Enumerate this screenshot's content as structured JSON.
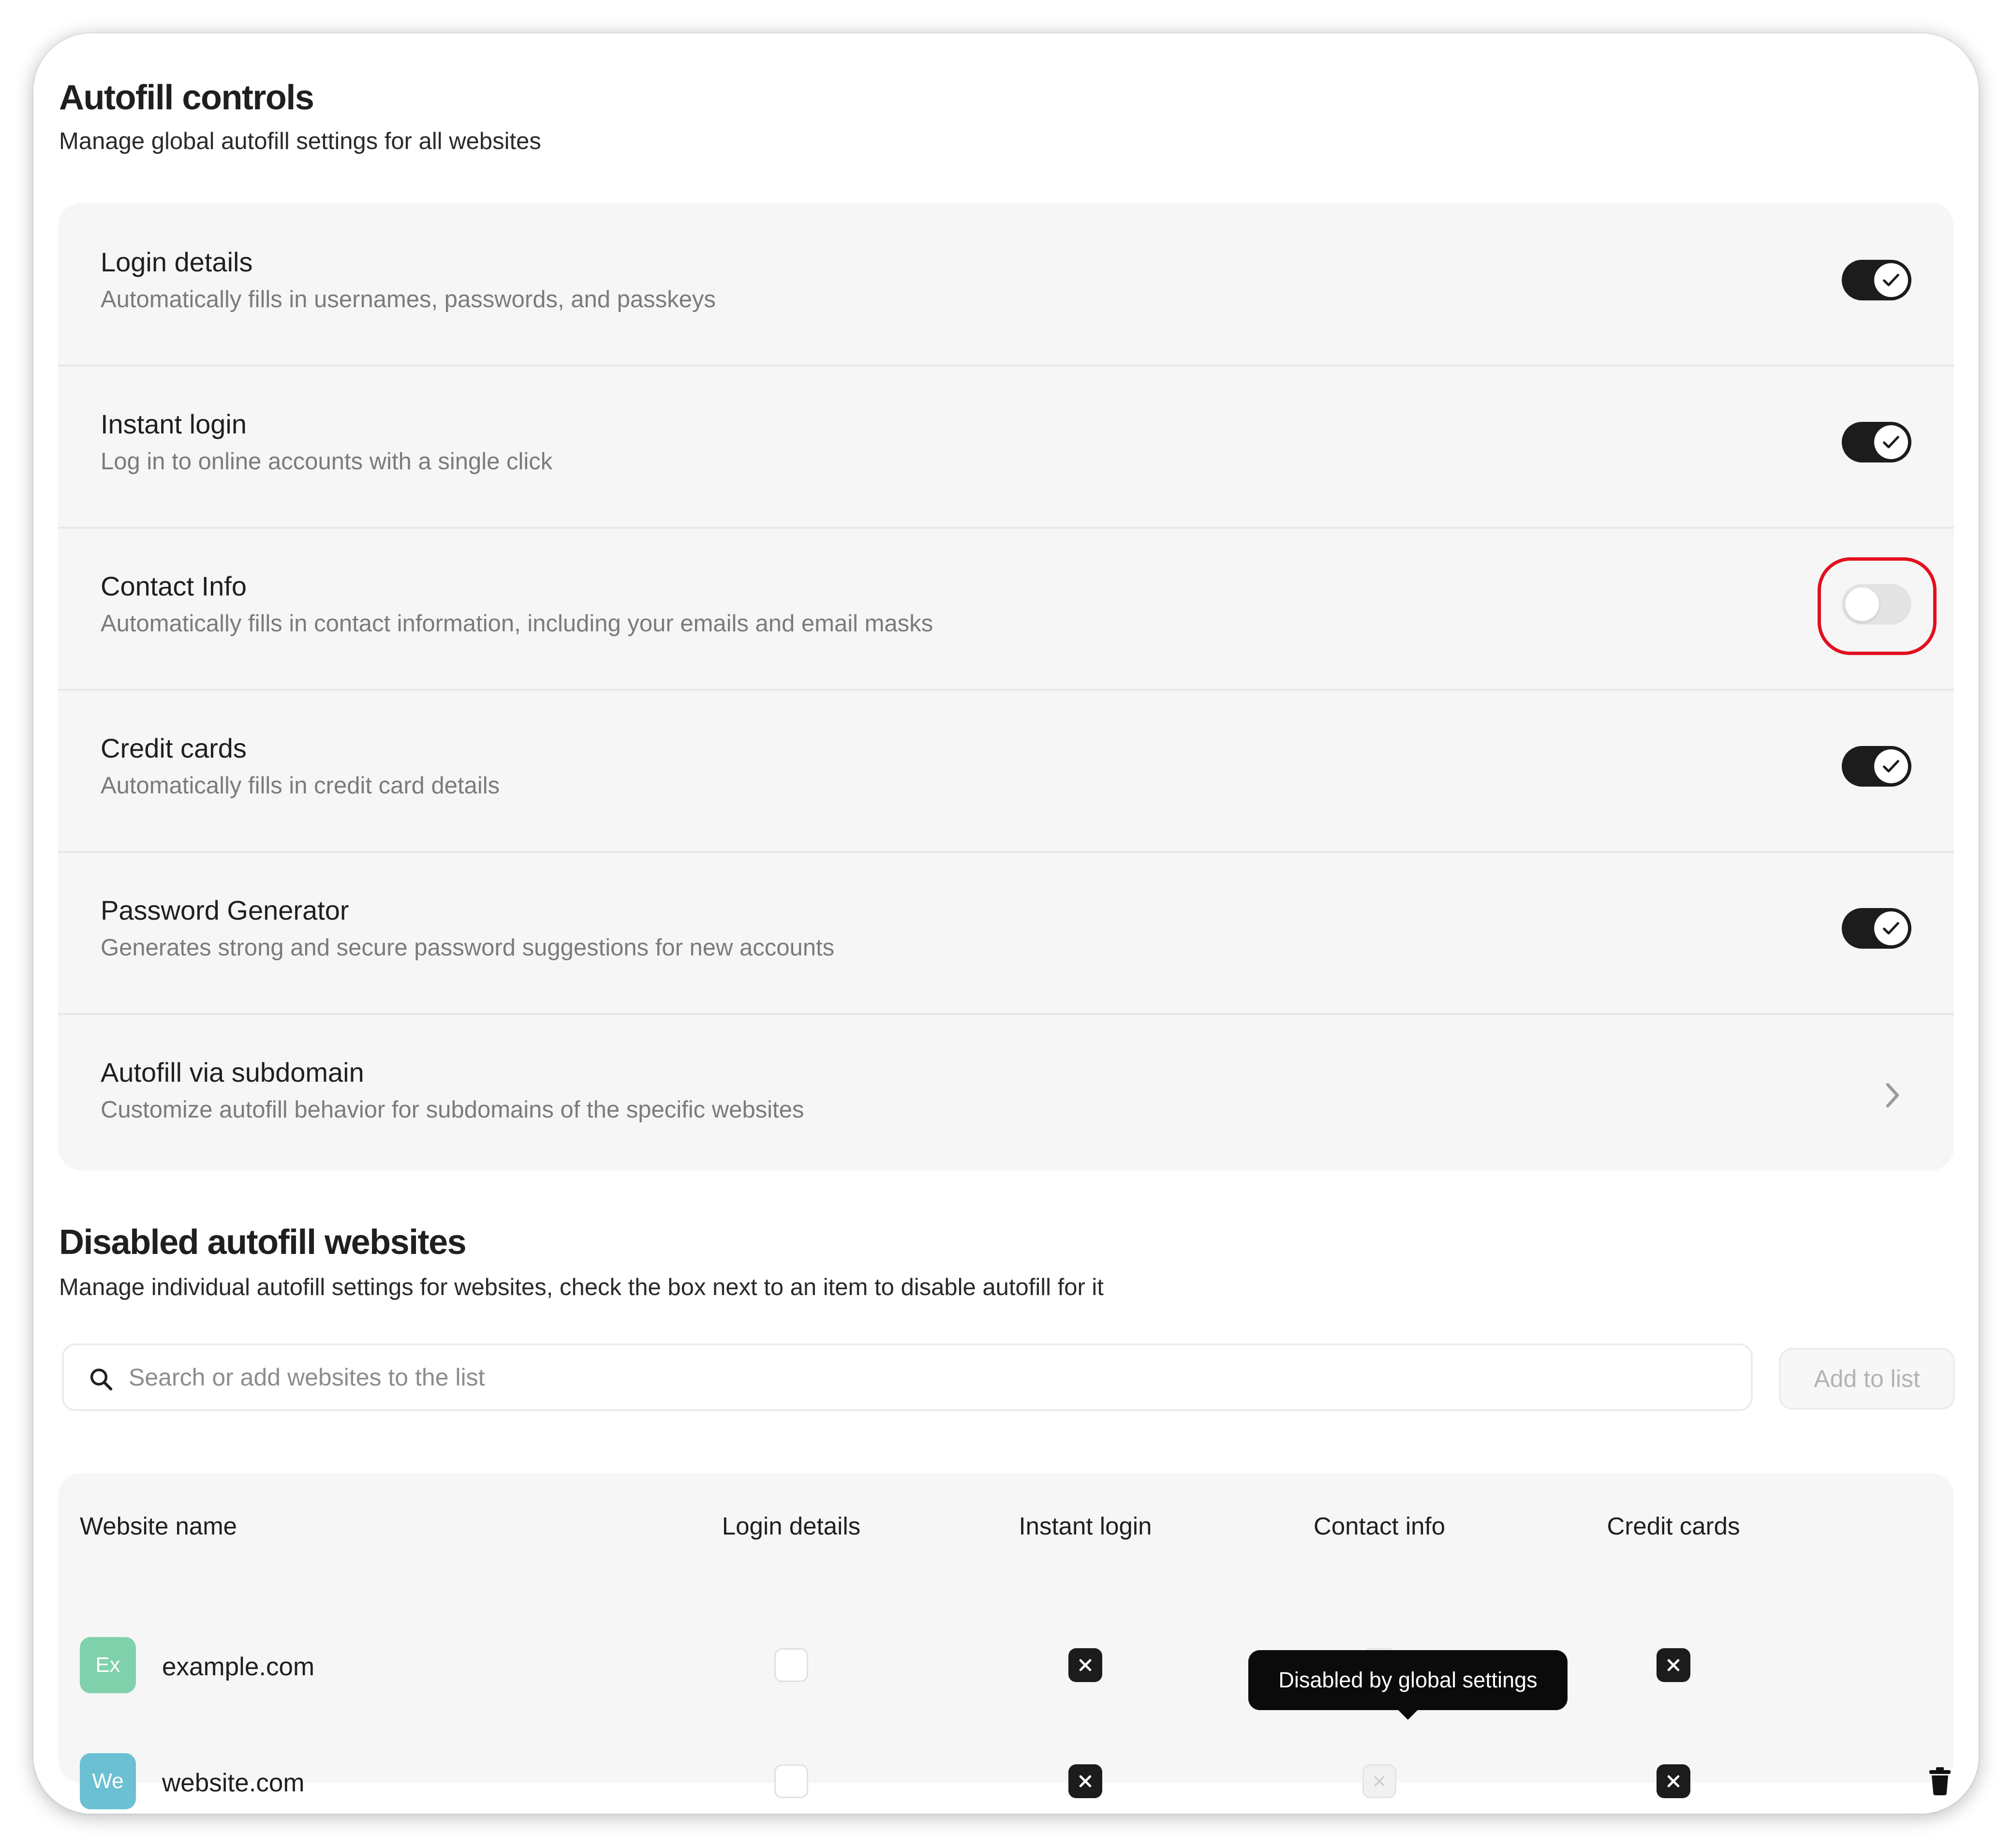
{
  "autofill": {
    "title": "Autofill controls",
    "subtitle": "Manage global autofill settings for all websites",
    "settings": [
      {
        "title": "Login details",
        "description": "Automatically fills in usernames, passwords, and passkeys",
        "control": "toggle",
        "enabled": true
      },
      {
        "title": "Instant login",
        "description": "Log in to online accounts with a single click",
        "control": "toggle",
        "enabled": true
      },
      {
        "title": "Contact Info",
        "description": "Automatically fills in contact information, including your emails and email masks",
        "control": "toggle",
        "enabled": false,
        "highlighted": true
      },
      {
        "title": "Credit cards",
        "description": "Automatically fills in credit card details",
        "control": "toggle",
        "enabled": true
      },
      {
        "title": "Password Generator",
        "description": "Generates strong and secure password suggestions for new accounts",
        "control": "toggle",
        "enabled": true
      },
      {
        "title": "Autofill via subdomain",
        "description": "Customize autofill behavior for subdomains of the specific websites",
        "control": "chevron-right-icon"
      }
    ]
  },
  "disabled_sites": {
    "title": "Disabled autofill websites",
    "subtitle": "Manage individual autofill settings for websites, check the box next to an item to disable autofill for it",
    "search": {
      "placeholder": "Search or add websites to the list",
      "value": ""
    },
    "add_button_label": "Add to list",
    "columns": [
      "Website name",
      "Login details",
      "Instant login",
      "Contact info",
      "Credit cards"
    ],
    "rows": [
      {
        "initials": "Ex",
        "avatar_color": "#7fd1ac",
        "name": "example.com",
        "login_details": "unchecked",
        "instant_login": "checked",
        "contact_info": "disabled",
        "credit_cards": "checked",
        "show_delete": false
      },
      {
        "initials": "We",
        "avatar_color": "#6cc0d3",
        "name": "website.com",
        "login_details": "unchecked",
        "instant_login": "checked",
        "contact_info": "disabled",
        "credit_cards": "checked",
        "show_delete": true
      }
    ],
    "tooltip": "Disabled by global settings"
  },
  "colors": {
    "accent": "#1c1c1c",
    "highlight": "#e3101f",
    "panel": "#f6f6f6"
  }
}
